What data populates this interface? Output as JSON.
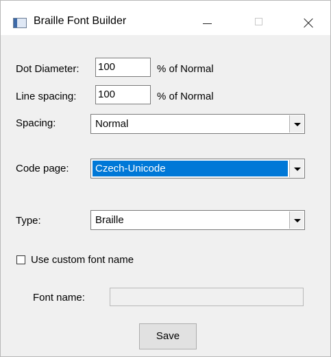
{
  "window": {
    "title": "Braille Font Builder",
    "icon": "app-window-icon",
    "controls": [
      "minimize-icon",
      "maximize-icon",
      "close-icon"
    ]
  },
  "form": {
    "dot_diameter_label": "Dot Diameter:",
    "dot_diameter_value": "100",
    "dot_diameter_unit": "% of Normal",
    "line_spacing_label": "Line spacing:",
    "line_spacing_value": "100",
    "line_spacing_unit": "% of Normal",
    "spacing_label": "Spacing:",
    "spacing_value": "Normal",
    "code_page_label": "Code page:",
    "code_page_value": "Czech-Unicode",
    "type_label": "Type:",
    "type_value": "Braille",
    "custom_font_label": "Use custom font name",
    "custom_font_checked": false,
    "font_name_label": "Font name:",
    "font_name_value": "",
    "save_label": "Save"
  },
  "colors": {
    "selection": "#0078d7",
    "window_bg": "#f0f0f0",
    "titlebar_bg": "#ffffff"
  }
}
